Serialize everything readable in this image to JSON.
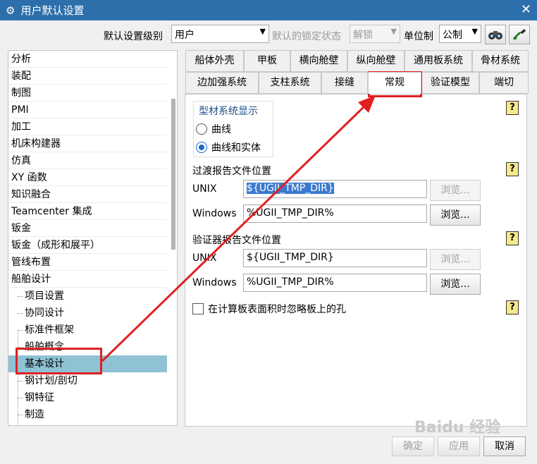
{
  "window": {
    "title": "用户默认设置",
    "close_glyph": "✕"
  },
  "toolbar": {
    "level_label": "默认设置级别",
    "level_value": "用户",
    "lock_label": "默认的锁定状态",
    "lock_value": "解锁",
    "unit_label": "单位制",
    "unit_value": "公制"
  },
  "tree": {
    "items": [
      {
        "label": "分析"
      },
      {
        "label": "装配"
      },
      {
        "label": "制图"
      },
      {
        "label": "PMI"
      },
      {
        "label": "加工"
      },
      {
        "label": "机床构建器"
      },
      {
        "label": "仿真"
      },
      {
        "label": "XY 函数"
      },
      {
        "label": "知识融合"
      },
      {
        "label": "Teamcenter 集成"
      },
      {
        "label": "钣金"
      },
      {
        "label": "钣金（成形和展平）"
      },
      {
        "label": "管线布置"
      },
      {
        "label": "船舶设计"
      }
    ],
    "children": [
      {
        "label": "项目设置"
      },
      {
        "label": "协同设计"
      },
      {
        "label": "标准件框架"
      },
      {
        "label": "船舶概念"
      },
      {
        "label": "基本设计"
      },
      {
        "label": "钢计划/剖切"
      },
      {
        "label": "钢特征"
      },
      {
        "label": "制造"
      }
    ]
  },
  "tabs": {
    "row1": [
      "船体外壳",
      "甲板",
      "横向舱壁",
      "纵向舱壁",
      "通用板系统",
      "骨材系统"
    ],
    "row2": [
      "边加强系统",
      "支柱系统",
      "接缝",
      "常规",
      "验证模型",
      "端切"
    ]
  },
  "panel": {
    "profile_group_title": "型材系统显示",
    "radio_curve": "曲线",
    "radio_curve_solid": "曲线和实体",
    "transition_report_title": "过渡报告文件位置",
    "validator_report_title": "验证器报告文件位置",
    "unix_label": "UNIX",
    "windows_label": "Windows",
    "unix_value": "${UGII_TMP_DIR}",
    "windows_value": "%UGII_TMP_DIR%",
    "browse_label": "浏览...",
    "ignore_holes_label": "在计算板表面积时忽略板上的孔",
    "help_glyph": "?"
  },
  "buttons": {
    "ok": "确定",
    "apply": "应用",
    "cancel": "取消"
  },
  "watermark": "Baidu 经验"
}
